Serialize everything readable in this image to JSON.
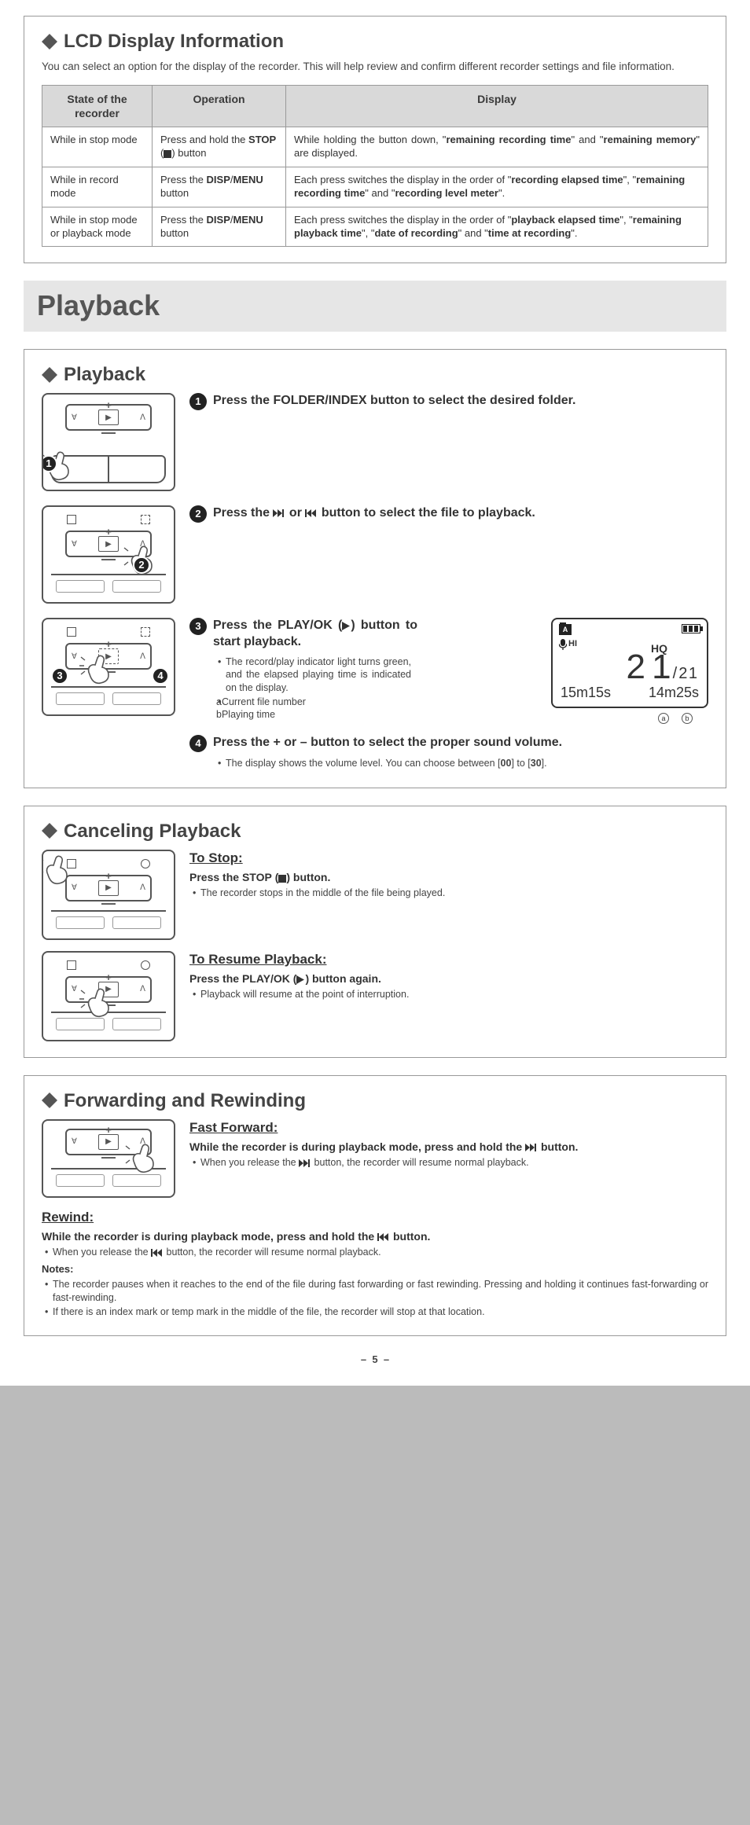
{
  "lcd_section": {
    "title": "LCD Display Information",
    "intro": "You can select an option for the display of the recorder. This will help review and confirm different recorder settings and file information.",
    "headers": [
      "State of the recorder",
      "Operation",
      "Display"
    ],
    "rows": [
      {
        "state": "While in stop mode",
        "op_pre": "Press and hold the ",
        "op_bold": "STOP",
        "op_paren": " (",
        "op_post": ") button",
        "disp_pre": "While holding the button down, \"",
        "disp_b1": "remaining recording time",
        "disp_mid1": "\" and \"",
        "disp_b2": "remaining memory",
        "disp_post": "\" are displayed."
      },
      {
        "state": "While in record mode",
        "op_pre": "Press the ",
        "op_bold": "DISP",
        "op_slash": "/",
        "op_bold2": "MENU",
        "op_post": " button",
        "disp_pre": "Each press switches the display in the order of \"",
        "disp_b1": "recording elapsed time",
        "disp_mid1": "\", \"",
        "disp_b2": "remaining recording time",
        "disp_mid2": "\" and \"",
        "disp_b3": "recording level meter",
        "disp_post": "\"."
      },
      {
        "state": "While in stop mode or playback mode",
        "op_pre": "Press the ",
        "op_bold": "DISP",
        "op_slash": "/",
        "op_bold2": "MENU",
        "op_post": " button",
        "disp_pre": "Each press switches the display in the order of \"",
        "disp_b1": "playback elapsed time",
        "disp_mid1": "\", \"",
        "disp_b2": "remaining playback time",
        "disp_mid2": "\", \"",
        "disp_b3": "date of recording",
        "disp_mid3": "\" and \"",
        "disp_b4": "time at recording",
        "disp_post": "\"."
      }
    ]
  },
  "playback_banner": "Playback",
  "playback_section": {
    "title": "Playback",
    "steps": [
      {
        "num": "1",
        "text_pre": "Press the ",
        "text_bold": "FOLDER/INDEX",
        "text_post": " button to select the desired folder."
      },
      {
        "num": "2",
        "text_pre": "Press the ",
        "text_mid": " or ",
        "text_post": " button to select the file to playback."
      },
      {
        "num": "3",
        "text_pre": "Press the ",
        "text_bold": "PLAY/OK",
        "text_paren_open": " (",
        "text_paren_close": ") ",
        "text_post": "button to start playback.",
        "bullets": [
          "The record/play indicator light turns green, and the elapsed playing time is indicated on the display.",
          "Current file number",
          "Playing time"
        ],
        "circ_a": "a",
        "circ_b": "b"
      },
      {
        "num": "4",
        "text_pre": "Press the ",
        "text_bold": "+",
        "text_mid": " or ",
        "text_bold2": "–",
        "text_post": "  button to select the proper sound volume.",
        "bullet_pre": "The display shows the volume level. You can choose between [",
        "bullet_b1": "00",
        "bullet_mid": "] to [",
        "bullet_b2": "30",
        "bullet_post": "]."
      }
    ],
    "lcd": {
      "folder": "A",
      "mic": "HI",
      "hq": "HQ",
      "file_cur": "2 1",
      "file_tot": "2 1",
      "time_a": "15m15s",
      "time_b": "14m25s"
    }
  },
  "cancel_section": {
    "title": "Canceling Playback",
    "stop": {
      "heading": "To Stop:",
      "action_pre": "Press the ",
      "action_bold": "STOP",
      "action_paren": " (",
      "action_post": ") button.",
      "bullet": "The recorder stops in the middle of the file being played."
    },
    "resume": {
      "heading": "To Resume Playback:",
      "action_pre": "Press the ",
      "action_bold": "PLAY/OK",
      "action_paren": " (",
      "action_post": ") button again.",
      "bullet": "Playback will resume at the point of interruption."
    }
  },
  "ff_section": {
    "title": "Forwarding and Rewinding",
    "ff": {
      "heading": "Fast Forward:",
      "action_pre": "While the recorder is during playback mode, press and hold the ",
      "action_post": " button.",
      "bullet_pre": "When you release the ",
      "bullet_post": " button, the recorder will resume normal playback."
    },
    "rw": {
      "heading": "Rewind:",
      "action_pre": "While the recorder is during playback mode, press and hold the ",
      "action_post": " button.",
      "bullet_pre": "When you release the ",
      "bullet_post": " button, the recorder will resume normal playback.",
      "notes_label": "Notes:",
      "notes": [
        "The recorder pauses when it reaches to the end of the file during fast forwarding or fast rewinding. Pressing and holding it continues fast-forwarding or fast-rewinding.",
        "If there is an index mark or temp mark in the middle of the file, the recorder will stop at that location."
      ]
    }
  },
  "page_num": "5"
}
